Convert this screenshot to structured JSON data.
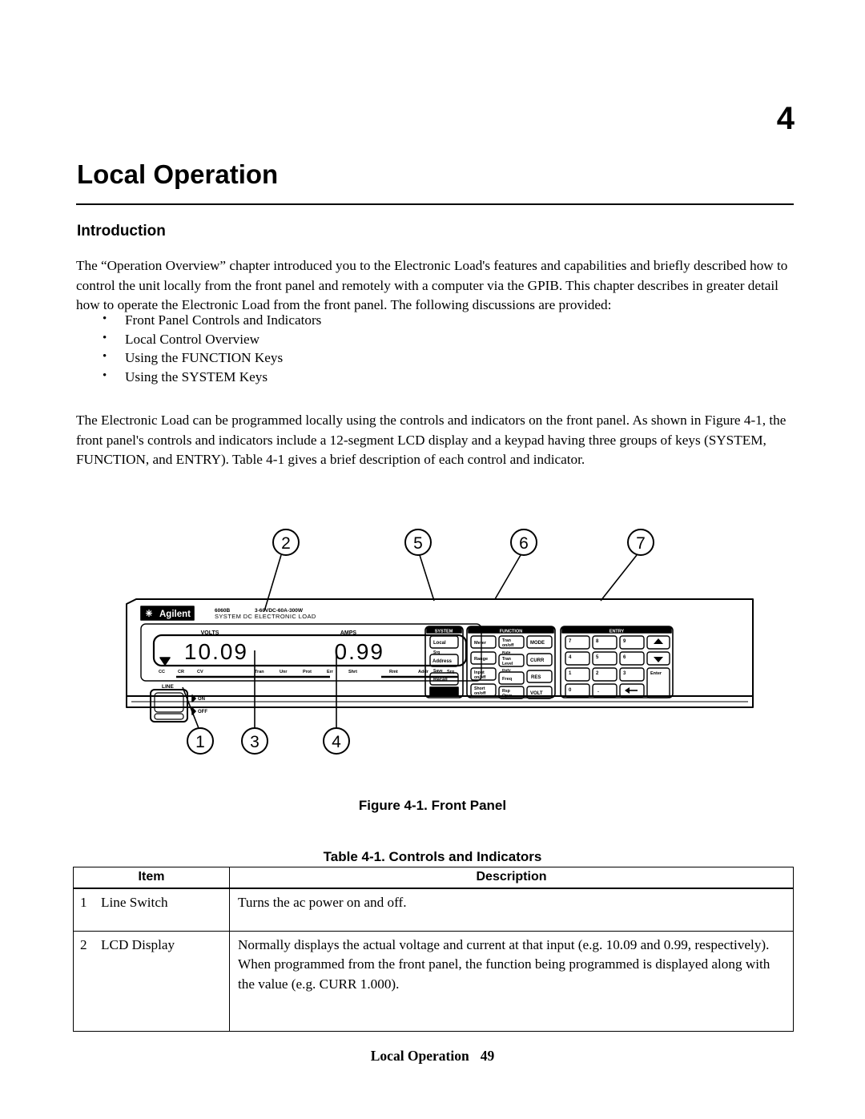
{
  "document": {
    "chapter_number": "4",
    "chapter_title": "Local Operation",
    "section_heading": "Introduction",
    "intro_paragraph": "The “Operation Overview” chapter introduced you to the Electronic Load's features and capabilities and briefly described how to control the unit locally from the front panel and remotely with a computer via the GPIB.  This chapter describes in greater detail how to operate the Electronic Load from the front panel.  The following discussions are provided:",
    "bullets": [
      "Front Panel Controls and Indicators",
      "Local Control Overview",
      "Using the FUNCTION Keys",
      "Using the SYSTEM Keys"
    ],
    "load_paragraph": "The Electronic Load can be programmed locally using the controls and indicators on the front panel.  As shown in Figure 4-1, the front panel's controls and indicators include a 12-segment LCD display and a keypad having three groups of keys (SYSTEM, FUNCTION, and ENTRY).  Table 4-1 gives a brief description of each control and indicator.",
    "figure_caption": "Figure 4-1.  Front Panel",
    "table_caption": "Table 4-1.  Controls and Indicators",
    "footer_text": "Local Operation",
    "page_number": "49"
  },
  "figure": {
    "brand": "Agilent",
    "model_line1": "6060B",
    "model_line2": "3-60VDC-60A-300W",
    "subtitle": "SYSTEM DC ELECTRONIC LOAD",
    "lcd": {
      "volts_label": "VOLTS",
      "amps_label": "AMPS",
      "volts_value": "10.09",
      "amps_value": "0.99",
      "annunciators": [
        "CC",
        "CR",
        "CV",
        "Tran",
        "Unr",
        "Prot",
        "Err",
        "Shrt",
        "Rmt",
        "Addr",
        "Srq"
      ]
    },
    "line_switch": {
      "label": "LINE",
      "on_label": "ON",
      "off_label": "OFF"
    },
    "keypads": [
      {
        "group": "SYSTEM",
        "keys": [
          {
            "label": "Local",
            "shift": ""
          },
          {
            "label": "Address",
            "shift": "Srq"
          },
          {
            "label": "Recall",
            "shift": "Save"
          },
          {
            "label": "",
            "shift": "",
            "filled": true
          }
        ]
      },
      {
        "group": "FUNCTION",
        "columns": [
          [
            {
              "label": "Meter",
              "shift": ""
            },
            {
              "label": "Range",
              "shift": ""
            },
            {
              "label": "Input\non/off",
              "shift": ""
            },
            {
              "label": "Short\non/off",
              "shift": ""
            }
          ],
          [
            {
              "label": "Tran\non/off",
              "shift": ""
            },
            {
              "label": "Tran\nLevel",
              "shift": "Rate"
            },
            {
              "label": "Freq",
              "shift": "Duty"
            },
            {
              "label": "Rsp\nOper",
              "shift": ""
            }
          ],
          [
            {
              "label": "MODE",
              "shift": ""
            },
            {
              "label": "CURR",
              "shift": ""
            },
            {
              "label": "RES",
              "shift": ""
            },
            {
              "label": "VOLT",
              "shift": ""
            }
          ]
        ]
      },
      {
        "group": "ENTRY",
        "rows": [
          [
            "7",
            "8",
            "9",
            "▲"
          ],
          [
            "4",
            "5",
            "6",
            "▼"
          ],
          [
            "1",
            "2",
            "3",
            "Enter"
          ],
          [
            "0",
            ".",
            "⌫",
            ""
          ]
        ]
      }
    ],
    "callouts": [
      "1",
      "2",
      "3",
      "4",
      "5",
      "6",
      "7"
    ]
  },
  "table": {
    "headers": [
      "Item",
      "Description"
    ],
    "rows": [
      {
        "num": "1",
        "item": "Line Switch",
        "description": "Turns the ac power on and off."
      },
      {
        "num": "2",
        "item": "LCD Display",
        "description": "Normally displays the actual voltage and current at that input (e.g.  10.09 and 0.99, respectively).  When programmed from the front panel, the function being programmed is displayed along with the value (e.g. CURR 1.000)."
      }
    ]
  }
}
